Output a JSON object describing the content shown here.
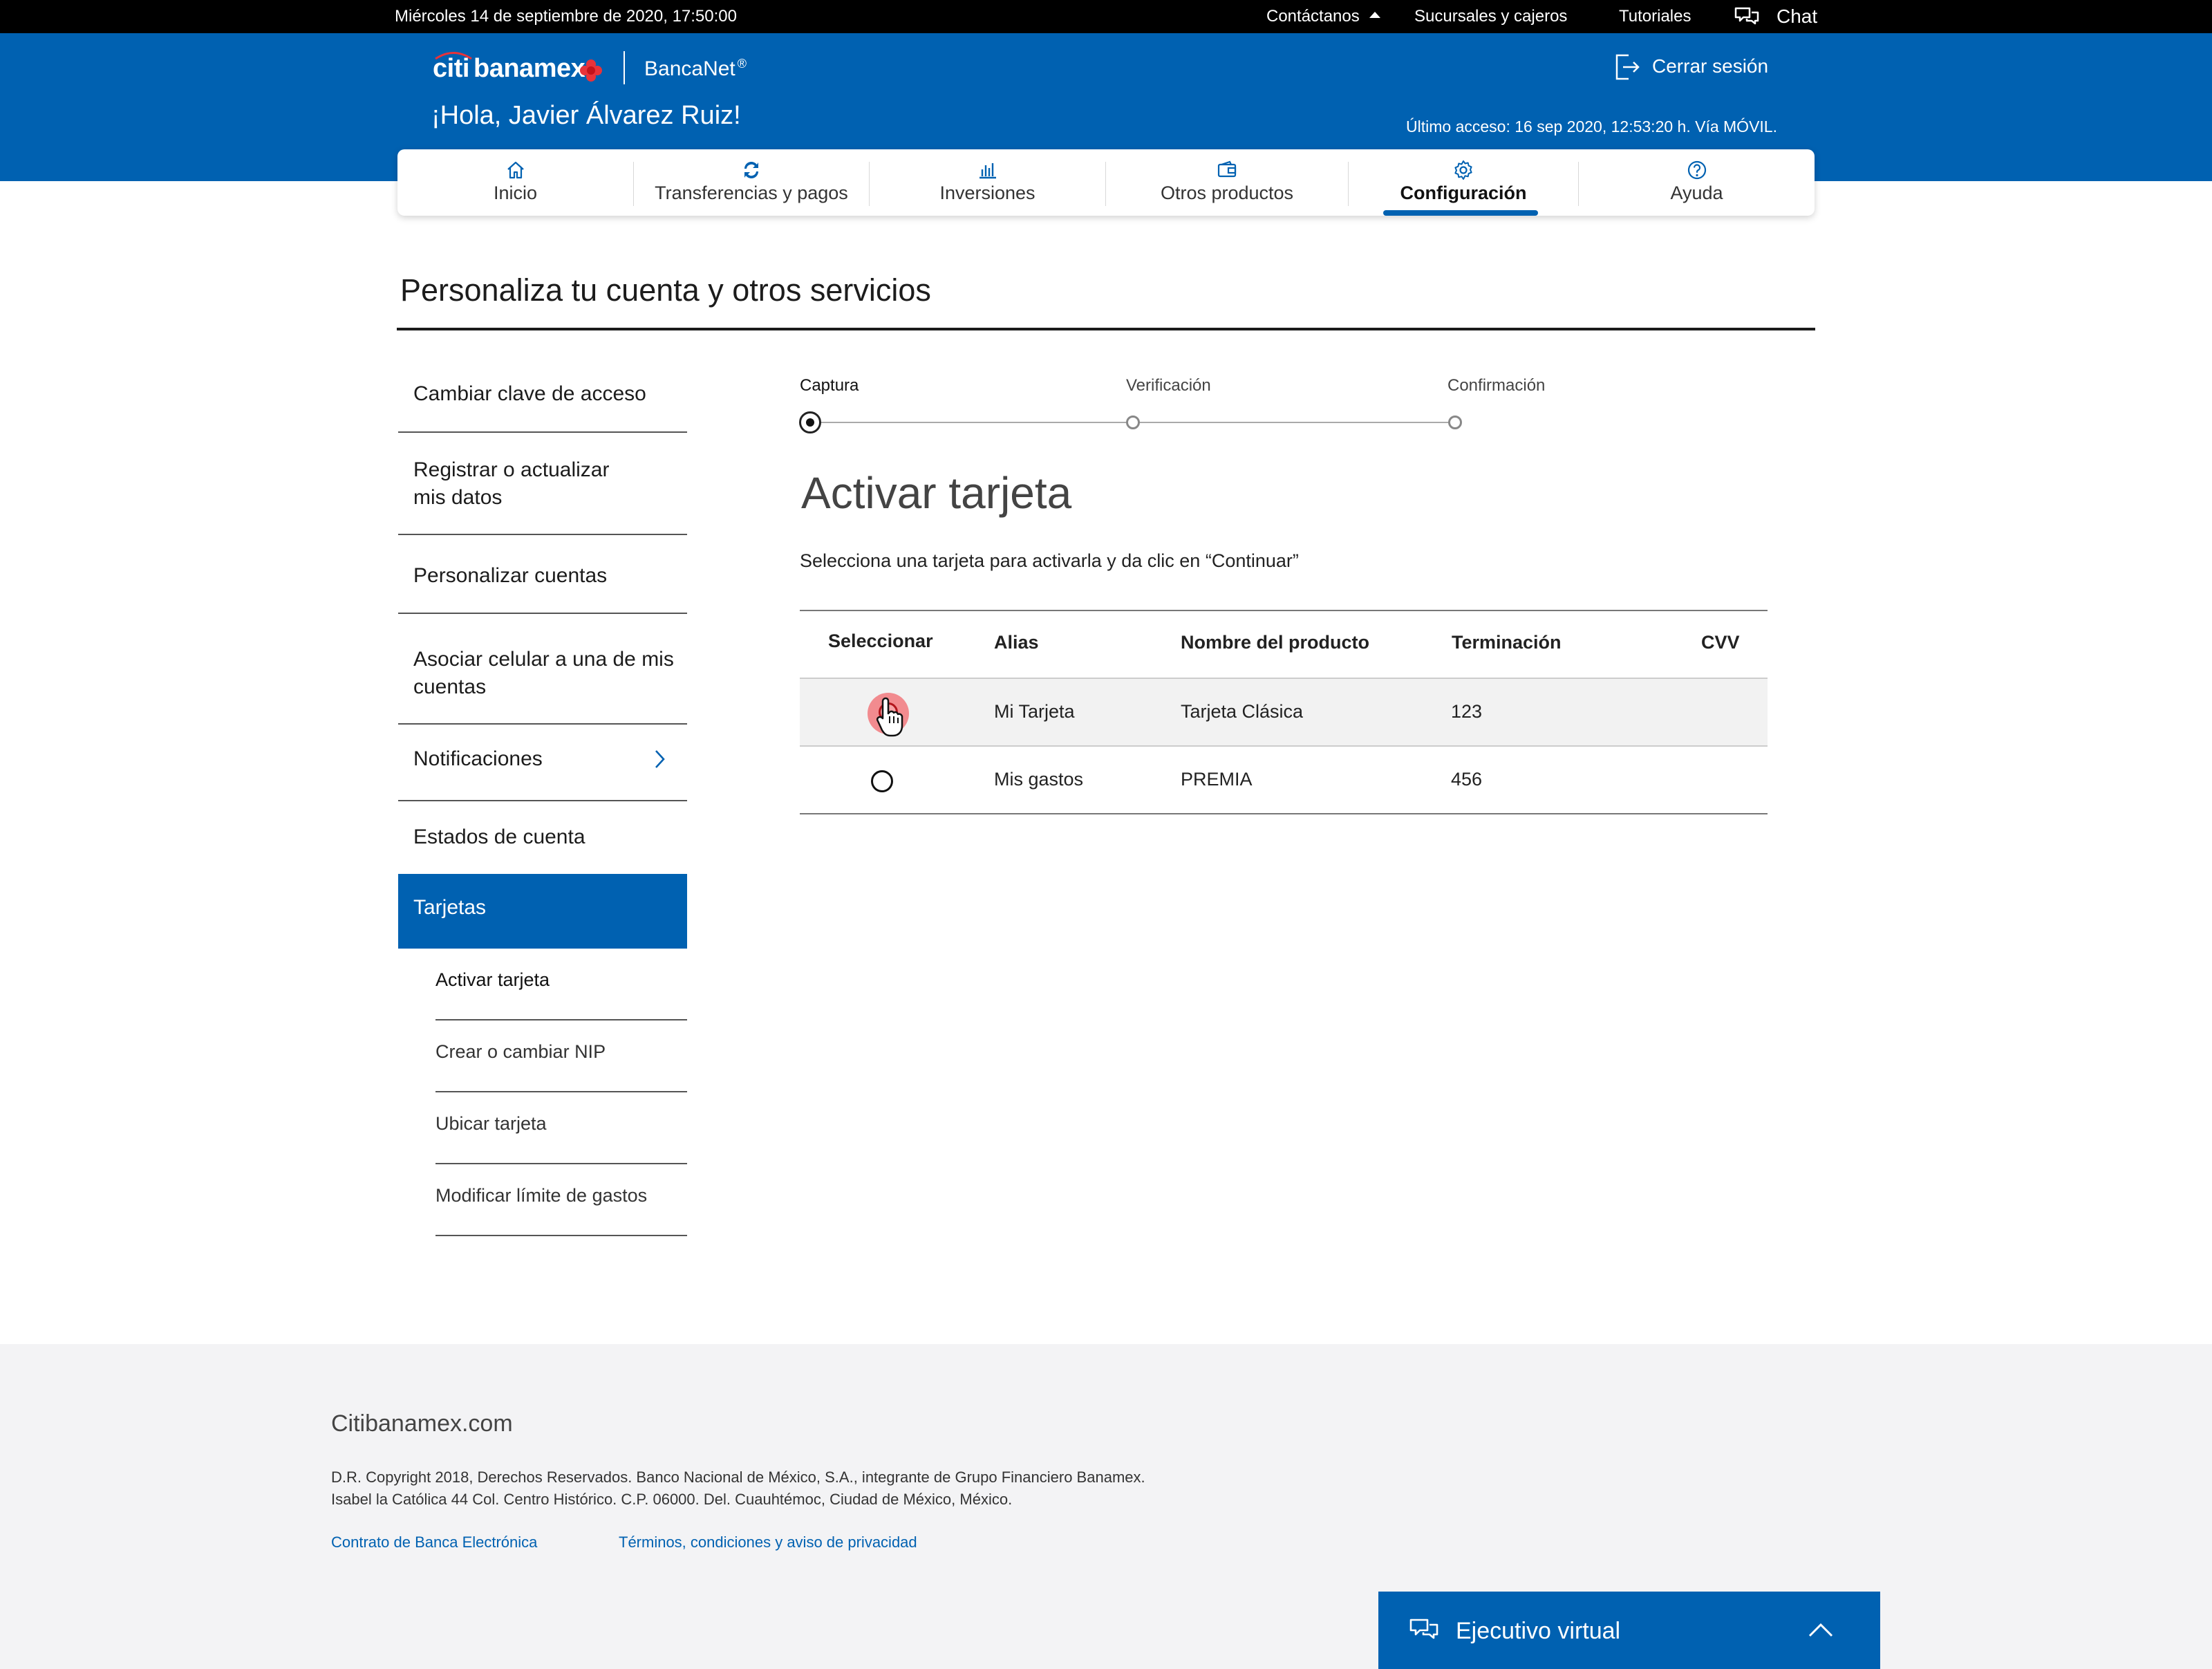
{
  "topbar": {
    "datetime": "Miércoles 14 de septiembre de 2020, 17:50:00",
    "contact_label": "Contáctanos",
    "branches_label": "Sucursales y cajeros",
    "tutorials_label": "Tutoriales",
    "chat_label": "Chat"
  },
  "header": {
    "brand_citi": "citi",
    "brand_banamex": "banamex",
    "product_name": "BancaNet",
    "product_mark": "®",
    "greeting": "¡Hola, Javier Álvarez Ruiz!",
    "logout_label": "Cerrar sesión",
    "last_access": "Último acceso: 16 sep 2020, 12:53:20 h. Vía MÓVIL."
  },
  "nav": {
    "items": [
      {
        "label": "Inicio",
        "icon": "home-icon"
      },
      {
        "label": "Transferencias y pagos",
        "icon": "transfer-icon"
      },
      {
        "label": "Inversiones",
        "icon": "chart-icon"
      },
      {
        "label": "Otros productos",
        "icon": "wallet-icon"
      },
      {
        "label": "Configuración",
        "icon": "gear-icon",
        "active": true
      },
      {
        "label": "Ayuda",
        "icon": "help-icon"
      }
    ]
  },
  "page": {
    "title": "Personaliza tu cuenta y otros servicios"
  },
  "sidebar": {
    "items": [
      {
        "label": "Cambiar clave de acceso"
      },
      {
        "label": "Registrar o actualizar mis datos"
      },
      {
        "label": "Personalizar cuentas"
      },
      {
        "label": "Asociar celular a una de mis cuentas"
      },
      {
        "label": "Notificaciones"
      },
      {
        "label": "Estados de cuenta"
      },
      {
        "label": "Tarjetas",
        "active": true
      }
    ],
    "subitems": [
      {
        "label": "Activar tarjeta",
        "active": true
      },
      {
        "label": "Crear o cambiar NIP"
      },
      {
        "label": "Ubicar tarjeta"
      },
      {
        "label": "Modificar límite de gastos"
      }
    ]
  },
  "stepper": {
    "steps": [
      {
        "label": "Captura",
        "current": true
      },
      {
        "label": "Verificación"
      },
      {
        "label": "Confirmación"
      }
    ]
  },
  "main": {
    "title": "Activar tarjeta",
    "instructions": "Selecciona una tarjeta para activarla y da clic en “Continuar”"
  },
  "table": {
    "headers": [
      "Seleccionar",
      "Alias",
      "Nombre del producto",
      "Terminación",
      "CVV"
    ],
    "rows": [
      {
        "alias": "Mi Tarjeta",
        "product": "Tarjeta Clásica",
        "ending": "123",
        "cvv": "",
        "highlighted": true
      },
      {
        "alias": "Mis gastos",
        "product": "PREMIA",
        "ending": "456",
        "cvv": "",
        "highlighted": false
      }
    ]
  },
  "footer": {
    "site": "Citibanamex.com",
    "copyright_line1": "D.R. Copyright 2018, Derechos Reservados. Banco Nacional de México, S.A., integrante de Grupo Financiero Banamex.",
    "copyright_line2": "Isabel la Católica 44 Col. Centro Histórico. C.P. 06000. Del. Cuauhtémoc, Ciudad de México, México.",
    "link_contract": "Contrato de Banca Electrónica",
    "link_terms": "Términos, condiciones y aviso de privacidad"
  },
  "virtual_agent": {
    "label": "Ejecutivo virtual"
  },
  "colors": {
    "brand_blue": "#0061b1",
    "topbar_black": "#000000",
    "accent_red": "#e8333a",
    "footer_gray": "#f3f3f5"
  }
}
